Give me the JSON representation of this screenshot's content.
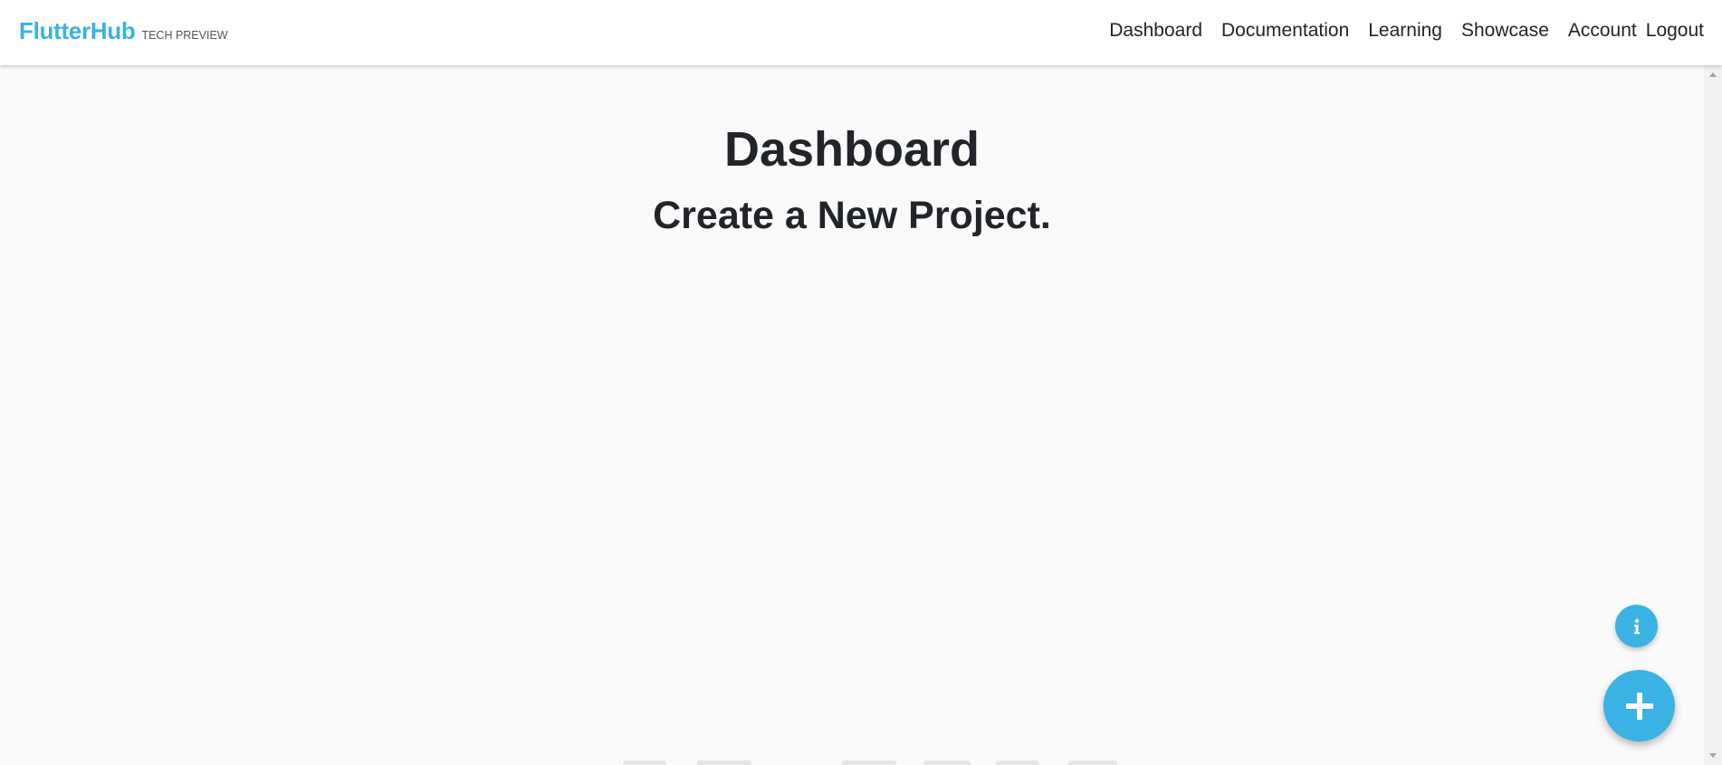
{
  "app": {
    "brand_name": "FlutterHub",
    "brand_tag": "TECH PREVIEW",
    "accent_color": "#3ab2e4"
  },
  "nav": {
    "items": [
      {
        "label": "Dashboard"
      },
      {
        "label": "Documentation"
      },
      {
        "label": "Learning"
      },
      {
        "label": "Showcase"
      },
      {
        "label": "Account"
      },
      {
        "label": "Logout"
      }
    ]
  },
  "main": {
    "title": "Dashboard",
    "subtitle": "Create a New Project."
  },
  "fabs": {
    "info_icon": "info-icon",
    "add_icon": "plus-icon"
  }
}
